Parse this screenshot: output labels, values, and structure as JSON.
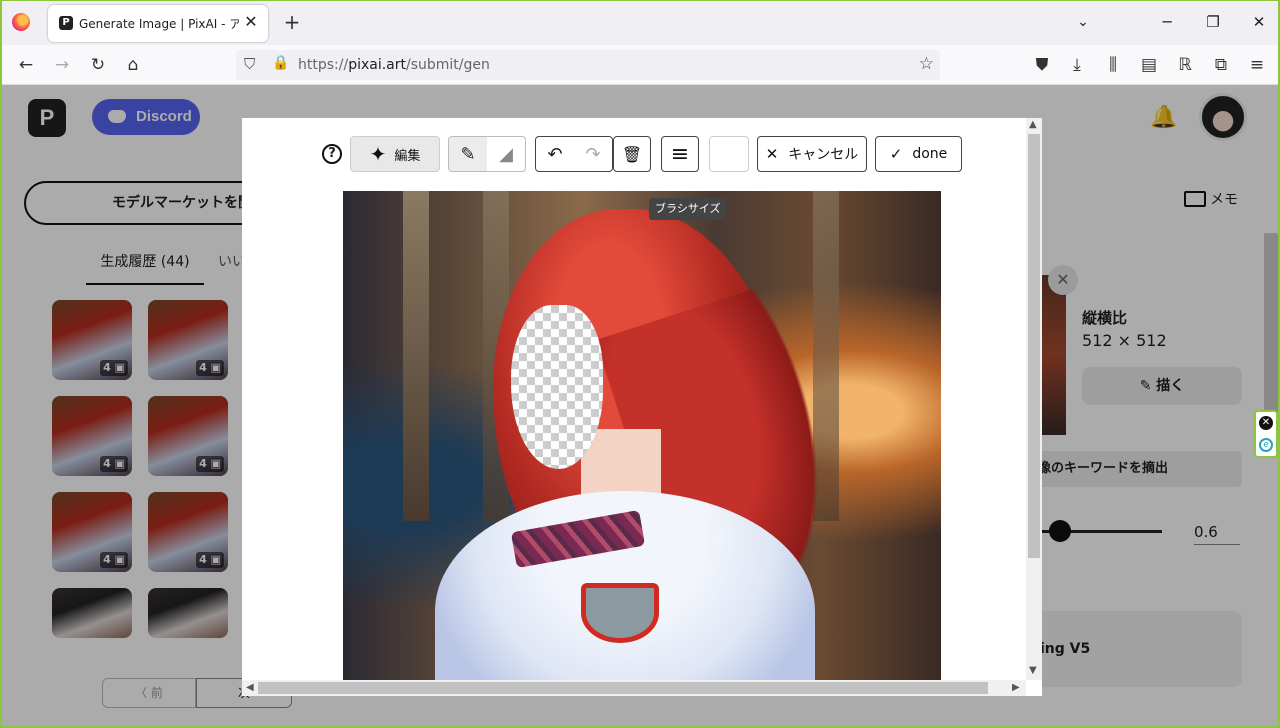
{
  "browser": {
    "tab_title": "Generate Image | PixAI - アニメなど",
    "tab_favicon": "P",
    "url_prefix": "https://",
    "url_domain": "pixai.art",
    "url_path": "/submit/gen"
  },
  "page": {
    "logo": "P",
    "discord_label": "Discord",
    "market_button": "モデルマーケットを閲覧",
    "history_tab": "生成履歴 (44)",
    "likes_tab": "いい",
    "thumb_count": "4 ▣",
    "pager_prev": "〈 前",
    "pager_next": "次",
    "memo_label": "メモ",
    "ratio_label": "縦横比",
    "ratio_value": "512 × 512",
    "draw_button": "✎ 描く",
    "keyword_label": "像のキーワードを摘出",
    "slider_value": "0.6",
    "model_name": "ing V5"
  },
  "editor": {
    "edit_label": "編集",
    "cancel_label": "キャンセル",
    "done_label": "done",
    "tooltip": "ブラシサイズ"
  },
  "icons": {
    "help": "?",
    "sparkle": "✦",
    "pencil": "✎",
    "eraser": "◢",
    "undo": "↶",
    "redo": "↷",
    "trash": "🗑",
    "menu": "≡",
    "close": "✕",
    "check": "✓"
  }
}
